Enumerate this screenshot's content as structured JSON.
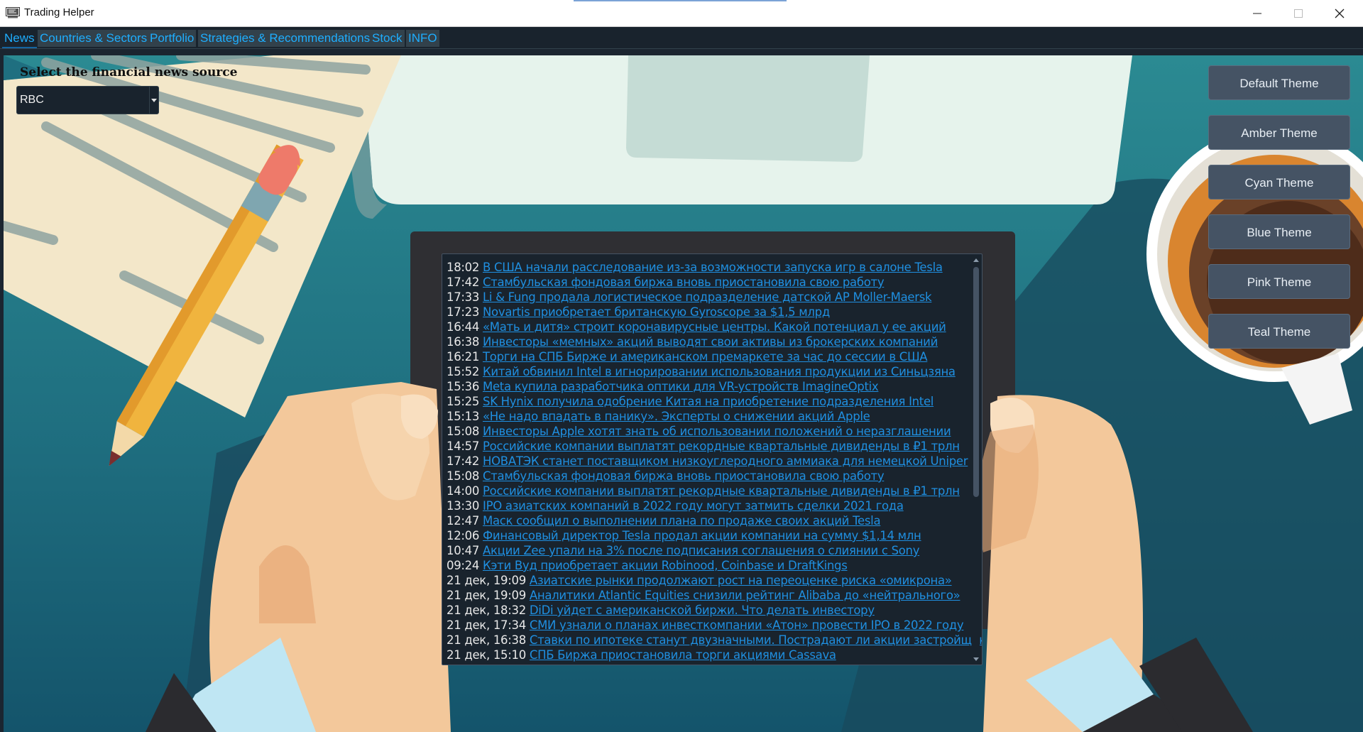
{
  "window": {
    "title": "Trading Helper"
  },
  "tabs": [
    {
      "label": "News",
      "active": true
    },
    {
      "label": "Countries & Sectors"
    },
    {
      "label": "Portfolio"
    },
    {
      "label": "Strategies & Recommendations"
    },
    {
      "label": "Stock"
    },
    {
      "label": "INFO"
    }
  ],
  "source": {
    "label": "Select the financial news source",
    "selected": "RBC"
  },
  "themes": [
    "Default Theme",
    "Amber Theme",
    "Cyan Theme",
    "Blue Theme",
    "Pink Theme",
    "Teal Theme"
  ],
  "news": [
    {
      "time": "18:02",
      "title": "В США начали расследование из-за возможности запуска игр в салоне Tesla"
    },
    {
      "time": "17:42",
      "title": "Стамбульская фондовая биржа вновь приостановила свою работу"
    },
    {
      "time": "17:33",
      "title": "Li & Fung продала логистическое подразделение датской AP Moller-Maersk"
    },
    {
      "time": "17:23",
      "title": "Novartis приобретает британскую Gyroscope за $1,5 млрд"
    },
    {
      "time": "16:44",
      "title": "«Мать и дитя» строит коронавирусные центры. Какой потенциал у ее акций"
    },
    {
      "time": "16:38",
      "title": "Инвесторы «мемных» акций выводят свои активы из брокерских компаний"
    },
    {
      "time": "16:21",
      "title": "Торги на СПБ Бирже и американском премаркете за час до сессии в США"
    },
    {
      "time": "15:52",
      "title": "Китай обвинил Intel в игнорировании использования продукции из Синьцзяна"
    },
    {
      "time": "15:36",
      "title": "Meta купила разработчика оптики для VR-устройств ImagineOptix"
    },
    {
      "time": "15:25",
      "title": "SK Hynix получила одобрение Китая на приобретение подразделения Intel"
    },
    {
      "time": "15:13",
      "title": "«Не надо впадать в панику». Эксперты о снижении акций Apple"
    },
    {
      "time": "15:08",
      "title": "Инвесторы Apple хотят знать об использовании положений о неразглашении"
    },
    {
      "time": "14:57",
      "title": "Российские компании выплатят рекордные квартальные дивиденды в ₽1 трлн"
    },
    {
      "time": "17:42",
      "title": "НОВАТЭК станет поставщиком низкоуглеродного аммиака для немецкой Uniper"
    },
    {
      "time": "15:08",
      "title": "Стамбульская фондовая биржа вновь приостановила свою работу"
    },
    {
      "time": "14:00",
      "title": "Российские компании выплатят рекордные квартальные дивиденды в ₽1 трлн"
    },
    {
      "time": "13:30",
      "title": "IPO азиатских компаний в 2022 году могут затмить сделки 2021 года"
    },
    {
      "time": "12:47",
      "title": "Маск сообщил о выполнении плана по продаже своих акций Tesla"
    },
    {
      "time": "12:06",
      "title": "Финансовый директор Tesla продал акции компании на сумму $1,14 млн"
    },
    {
      "time": "10:47",
      "title": "Акции Zee упали на 3% после подписания соглашения о слиянии с Sony"
    },
    {
      "time": "09:24",
      "title": "Кэти Вуд приобретает акции Robinood, Coinbase и DraftKings"
    },
    {
      "time": "21 дек, 19:09",
      "title": "Азиатские рынки продолжают рост на переоценке риска «омикрона»"
    },
    {
      "time": "21 дек, 19:09",
      "title": "Аналитики Atlantic Equities снизили рейтинг Alibaba до «нейтрального»"
    },
    {
      "time": "21 дек, 18:32",
      "title": "DiDi уйдет с американской биржи. Что делать инвестору"
    },
    {
      "time": "21 дек, 17:34",
      "title": "СМИ узнали о планах инвесткомпании «Атон» провести IPO в 2022 году"
    },
    {
      "time": "21 дек, 16:38",
      "title": "Ставки по ипотеке станут двузначными. Пострадают ли акции застройщиков?"
    },
    {
      "time": "21 дек, 15:10",
      "title": "СПБ Биржа приостановила торги акциями Cassava"
    }
  ],
  "icons": {
    "app": "terminal-icon",
    "minimize": "minimize-icon",
    "maximize": "maximize-icon",
    "close": "close-icon",
    "dropdown": "chevron-down-icon"
  },
  "colors": {
    "link": "#1f8fe0",
    "tab_text": "#1eaeff",
    "panel": "#19232d",
    "button": "#455364"
  }
}
